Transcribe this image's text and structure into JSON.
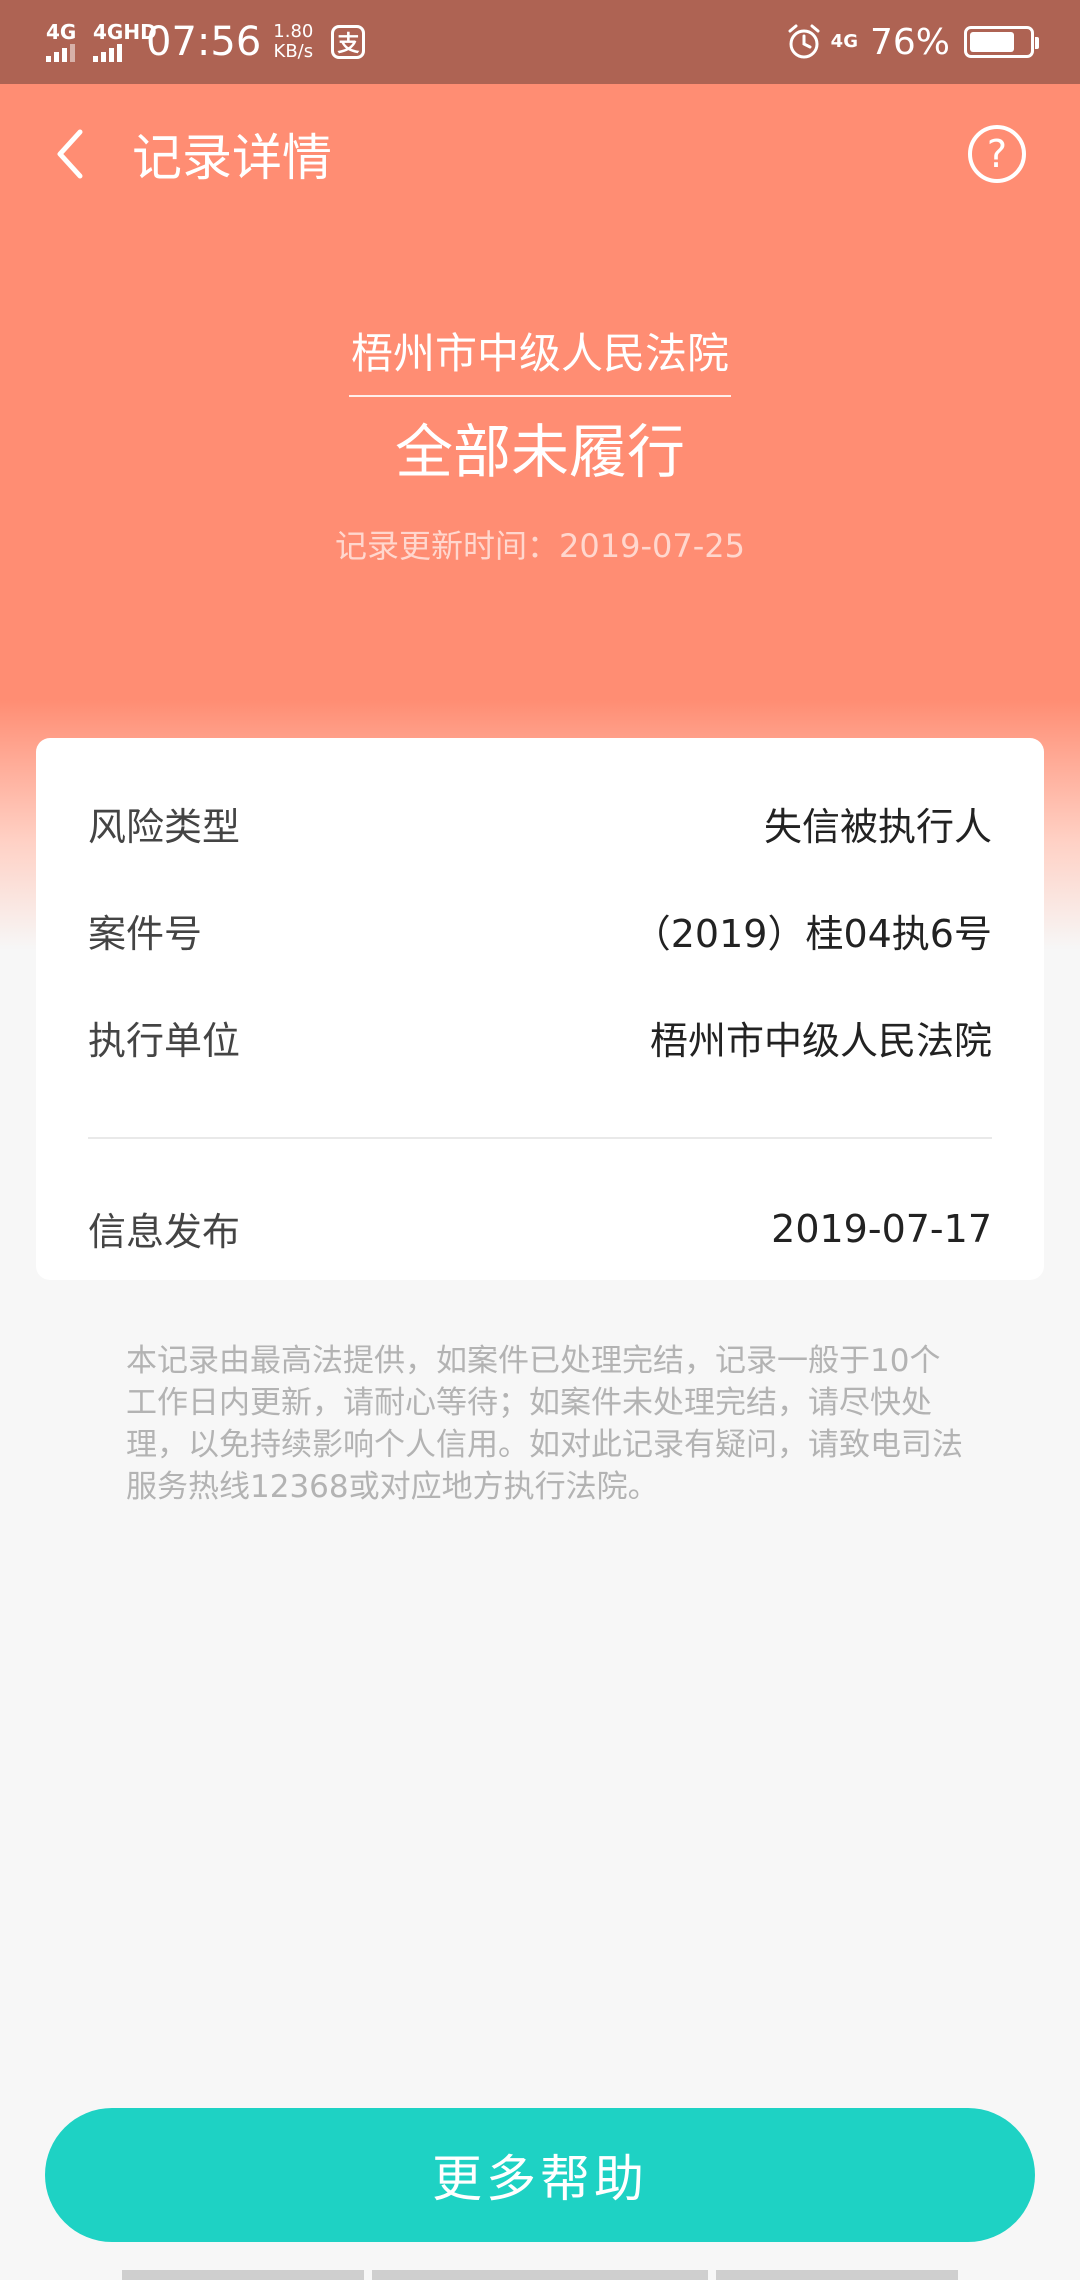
{
  "status_bar": {
    "net1": "4G",
    "net2": "4GHD",
    "time": "07:56",
    "speed_value": "1.80",
    "speed_unit": "KB/s",
    "net3": "4G",
    "battery": "76%",
    "battery_level": 0.76
  },
  "nav": {
    "title": "记录详情",
    "help_symbol": "?"
  },
  "hero": {
    "court_name": "梧州市中级人民法院",
    "status": "全部未履行",
    "update_label": "记录更新时间：",
    "update_date": "2019-07-25"
  },
  "card": {
    "rows": [
      {
        "label": "风险类型",
        "value": "失信被执行人"
      },
      {
        "label": "案件号",
        "value": "（2019）桂04执6号"
      },
      {
        "label": "执行单位",
        "value": "梧州市中级人民法院"
      },
      {
        "label": "信息发布",
        "value": "2019-07-17"
      }
    ]
  },
  "note": "本记录由最高法提供，如案件已处理完结，记录一般于10个工作日内更新，请耐心等待；如案件未处理完结，请尽快处理，以免持续影响个人信用。如对此记录有疑问，请致电司法服务热线12368或对应地方执行法院。",
  "button": {
    "label": "更多帮助"
  },
  "colors": {
    "status_bar": "#ae6353",
    "hero": "#ff8d73",
    "accent_button": "#1ed2c4"
  }
}
